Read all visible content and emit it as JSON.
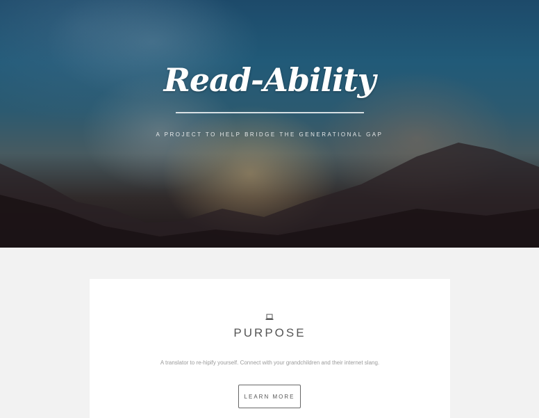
{
  "header": {
    "title": "Read-Ability",
    "subtitle": "A PROJECT TO HELP BRIDGE THE GENERATIONAL GAP"
  },
  "purpose_card": {
    "icon": "laptop-icon",
    "heading": "PURPOSE",
    "description": "A translator to re-hipify yourself. Connect with your grandchildren and their internet slang.",
    "button_label": "LEARN MORE"
  },
  "colors": {
    "page_background": "#f2f2f2",
    "card_background": "#ffffff",
    "hero_text": "#ffffff",
    "heading_text": "#555555"
  }
}
